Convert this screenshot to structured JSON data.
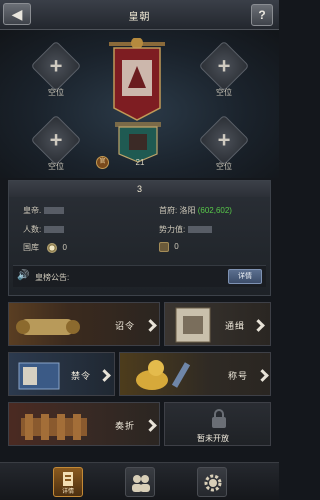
{
  "header": {
    "back_icon": "back-arrow-icon",
    "title": "皇朝",
    "help_label": "?"
  },
  "court": {
    "slots": [
      {
        "label": "空位"
      },
      {
        "label": "空位"
      },
      {
        "label": "空位"
      },
      {
        "label": "空位"
      }
    ],
    "level": "21",
    "level_badge": "官"
  },
  "info": {
    "rank": "3",
    "emperor_label": "皇帝.",
    "capital_label": "首府:",
    "capital_city": "洛阳",
    "capital_coords": "(602,602)",
    "population_label": "人数:",
    "power_label": "势力值:",
    "treasury_label": "国库",
    "treasury_value": "0",
    "seal_value": "0",
    "notice_label": "皇榜公告:",
    "detail_button": "详情"
  },
  "menu": {
    "edict": "诏令",
    "wanted": "通缉",
    "ban": "禁令",
    "title": "称号",
    "memorial": "奏折",
    "locked": "暂未开放"
  },
  "bottom_nav": {
    "details": "详情"
  },
  "colors": {
    "accent_green": "#58c94a",
    "detail_button_blue": "#4a5d80",
    "active_tab": "#8a5a1f"
  }
}
